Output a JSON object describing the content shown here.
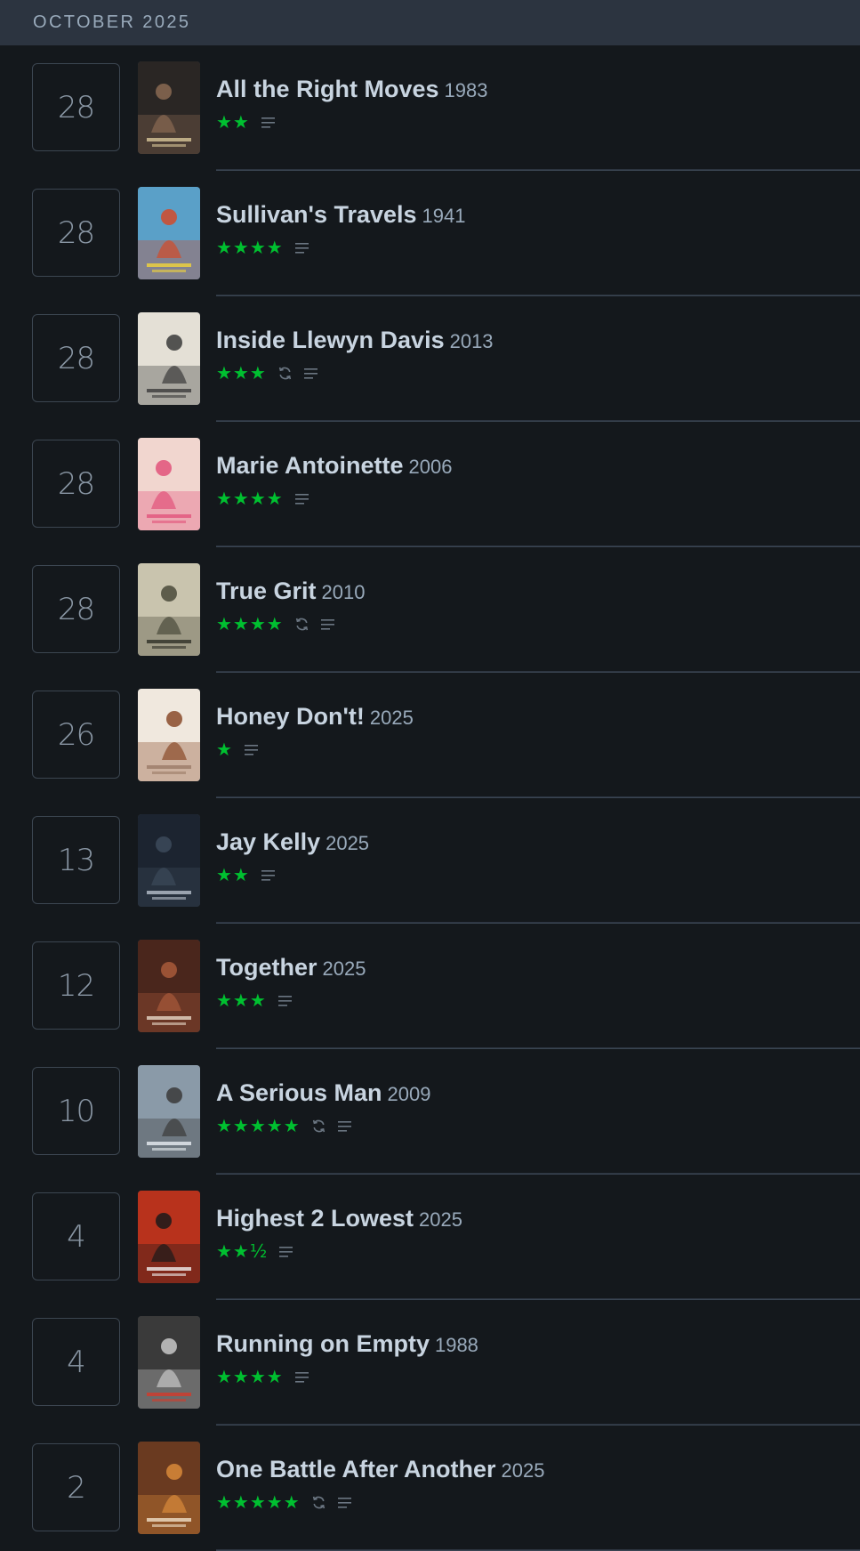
{
  "month_header": "OCTOBER 2025",
  "colors": {
    "star": "#00c030",
    "header_bg": "#2c3440",
    "page_bg": "#14181c"
  },
  "entries": [
    {
      "day": "28",
      "title": "All the Right Moves",
      "year": "1983",
      "stars": "★★",
      "rating": 2,
      "rewatch": false,
      "review": true
    },
    {
      "day": "28",
      "title": "Sullivan's Travels",
      "year": "1941",
      "stars": "★★★★",
      "rating": 4,
      "rewatch": false,
      "review": true
    },
    {
      "day": "28",
      "title": "Inside Llewyn Davis",
      "year": "2013",
      "stars": "★★★",
      "rating": 3,
      "rewatch": true,
      "review": true
    },
    {
      "day": "28",
      "title": "Marie Antoinette",
      "year": "2006",
      "stars": "★★★★",
      "rating": 4,
      "rewatch": false,
      "review": true
    },
    {
      "day": "28",
      "title": "True Grit",
      "year": "2010",
      "stars": "★★★★",
      "rating": 4,
      "rewatch": true,
      "review": true
    },
    {
      "day": "26",
      "title": "Honey Don't!",
      "year": "2025",
      "stars": "★",
      "rating": 1,
      "rewatch": false,
      "review": true
    },
    {
      "day": "13",
      "title": "Jay Kelly",
      "year": "2025",
      "stars": "★★",
      "rating": 2,
      "rewatch": false,
      "review": true
    },
    {
      "day": "12",
      "title": "Together",
      "year": "2025",
      "stars": "★★★",
      "rating": 3,
      "rewatch": false,
      "review": true
    },
    {
      "day": "10",
      "title": "A Serious Man",
      "year": "2009",
      "stars": "★★★★★",
      "rating": 5,
      "rewatch": true,
      "review": true
    },
    {
      "day": "4",
      "title": "Highest 2 Lowest",
      "year": "2025",
      "stars": "★★½",
      "rating": 2.5,
      "rewatch": false,
      "review": true
    },
    {
      "day": "4",
      "title": "Running on Empty",
      "year": "1988",
      "stars": "★★★★",
      "rating": 4,
      "rewatch": false,
      "review": true
    },
    {
      "day": "2",
      "title": "One Battle After Another",
      "year": "2025",
      "stars": "★★★★★",
      "rating": 5,
      "rewatch": true,
      "review": true
    }
  ],
  "posters": [
    {
      "bg": "#2a2624",
      "accent": "#8a6a52",
      "text": "#d8c79a",
      "icon": "poster-all-the-right-moves"
    },
    {
      "bg": "#5aa0c8",
      "accent": "#d24a2a",
      "text": "#f2d43a",
      "icon": "poster-sullivans-travels"
    },
    {
      "bg": "#e4e0d6",
      "accent": "#3a3a3a",
      "text": "#3a3a3a",
      "icon": "poster-inside-llewyn-davis"
    },
    {
      "bg": "#f1d6cf",
      "accent": "#e2527a",
      "text": "#e2527a",
      "icon": "poster-marie-antoinette"
    },
    {
      "bg": "#c9c4ae",
      "accent": "#4a4a3a",
      "text": "#2e2e26",
      "icon": "poster-true-grit"
    },
    {
      "bg": "#f0e8de",
      "accent": "#8a4a2a",
      "text": "#9a7a66",
      "icon": "poster-honey-dont"
    },
    {
      "bg": "#1c2430",
      "accent": "#3c4a5a",
      "text": "#b8c0cc",
      "icon": "poster-jay-kelly"
    },
    {
      "bg": "#4a261c",
      "accent": "#a85a3a",
      "text": "#e8d8c8",
      "icon": "poster-together"
    },
    {
      "bg": "#8a9aa8",
      "accent": "#3a3a3a",
      "text": "#e8eef2",
      "icon": "poster-a-serious-man"
    },
    {
      "bg": "#b8321c",
      "accent": "#1a1a1a",
      "text": "#f0f0f0",
      "icon": "poster-highest-2-lowest"
    },
    {
      "bg": "#3a3a3a",
      "accent": "#c8c8c8",
      "text": "#d43a2a",
      "icon": "poster-running-on-empty"
    },
    {
      "bg": "#6a3a20",
      "accent": "#d88a3a",
      "text": "#f0e0c8",
      "icon": "poster-one-battle-after-another"
    }
  ]
}
